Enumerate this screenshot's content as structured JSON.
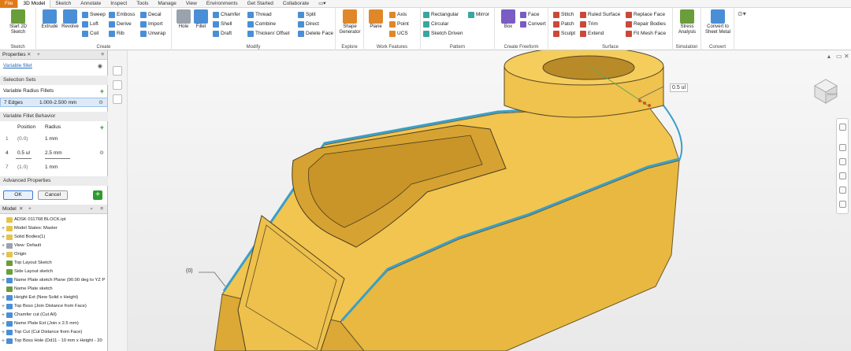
{
  "tabs": [
    "File",
    "3D Model",
    "Sketch",
    "Annotate",
    "Inspect",
    "Tools",
    "Manage",
    "View",
    "Environments",
    "Get Started",
    "Collaborate"
  ],
  "ribbon": {
    "sketch": {
      "start_sketch": "Start 2D Sketch",
      "panel_label": "Sketch"
    },
    "create": {
      "extrude": "Extrude",
      "revolve": "Revolve",
      "sweep": "Sweep",
      "loft": "Loft",
      "coil": "Coil",
      "emboss": "Emboss",
      "derive": "Derive",
      "rib": "Rib",
      "decal": "Decal",
      "import": "Import",
      "unwrap": "Unwrap",
      "panel_label": "Create"
    },
    "modify": {
      "hole": "Hole",
      "fillet": "Fillet",
      "chamfer": "Chamfer",
      "shell": "Shell",
      "draft": "Draft",
      "thread": "Thread",
      "combine": "Combine",
      "thicken": "Thicken/ Offset",
      "split": "Split",
      "direct": "Direct",
      "delete_face": "Delete Face",
      "panel_label": "Modify"
    },
    "explore": {
      "shape_generator": "Shape Generator",
      "panel_label": "Explore"
    },
    "work_features": {
      "plane": "Plane",
      "axis": "Axis",
      "point": "Point",
      "ucs": "UCS",
      "panel_label": "Work Features"
    },
    "pattern": {
      "rectangular": "Rectangular",
      "circular": "Circular",
      "sketch_driven": "Sketch Driven",
      "mirror": "Mirror",
      "panel_label": "Pattern"
    },
    "freeform": {
      "box": "Box",
      "face": "Face",
      "convert": "Convert",
      "panel_label": "Create Freeform"
    },
    "surface": {
      "stitch": "Stitch",
      "patch": "Patch",
      "sculpt": "Sculpt",
      "ruled_surface": "Ruled Surface",
      "trim": "Trim",
      "extend": "Extend",
      "replace_face": "Replace Face",
      "repair_bodies": "Repair Bodies",
      "fit_mesh_face": "Fit Mesh Face",
      "panel_label": "Surface"
    },
    "simulation": {
      "stress_analysis": "Stress Analysis",
      "panel_label": "Simulation"
    },
    "convert": {
      "convert_sheet_metal": "Convert to Sheet Metal",
      "panel_label": "Convert"
    }
  },
  "properties": {
    "header": "Properties",
    "feature": "Variable fillet",
    "selection_sets": "Selection Sets",
    "variable_radius_fillets": "Variable Radius Fillets",
    "edges_label": "7 Edges",
    "edges_range": "1.000-2.500 mm",
    "behavior": "Variable Fillet Behavior",
    "col_position": "Position",
    "col_radius": "Radius",
    "points": [
      {
        "idx": "1",
        "pos": "(0.0)",
        "radius": "1 mm"
      },
      {
        "idx": "4",
        "pos": "0.5 ul",
        "radius": "2.5 mm"
      },
      {
        "idx": "7",
        "pos": "(1.0)",
        "radius": "1 mm"
      }
    ],
    "advanced": "Advanced Properties",
    "ok": "OK",
    "cancel": "Cancel"
  },
  "browser": {
    "header": "Model",
    "nodes": [
      "ADSK 011768 BLOCK.ipt",
      "Model States: Master",
      "Solid Bodies(1)",
      "View: Default",
      "Origin",
      "Top Layout Sketch",
      "Side Layout sketch",
      "Name Plate sketch Plane (90.00 deg to YZ P",
      "Name Plate sketch",
      "Height Ext (New Solid x Height)",
      "Top Boss (Join Distance from Face)",
      "Chamfer cut (Cut All)",
      "Name Plate Ext (Join x 2.5 mm)",
      "Top Cut (Cut Distance from Face)",
      "Top Boss Hole (Dd11 - 10 mm x Height - 20"
    ]
  },
  "viewport": {
    "callout_top": "0.5 ul",
    "callout_left": "(0)",
    "viewcube_label": "RIGHT"
  },
  "colors": {
    "part": "#f3c85a",
    "part_dark": "#d9a935",
    "edge": "#3aa0c8",
    "file": "#e07a18"
  }
}
